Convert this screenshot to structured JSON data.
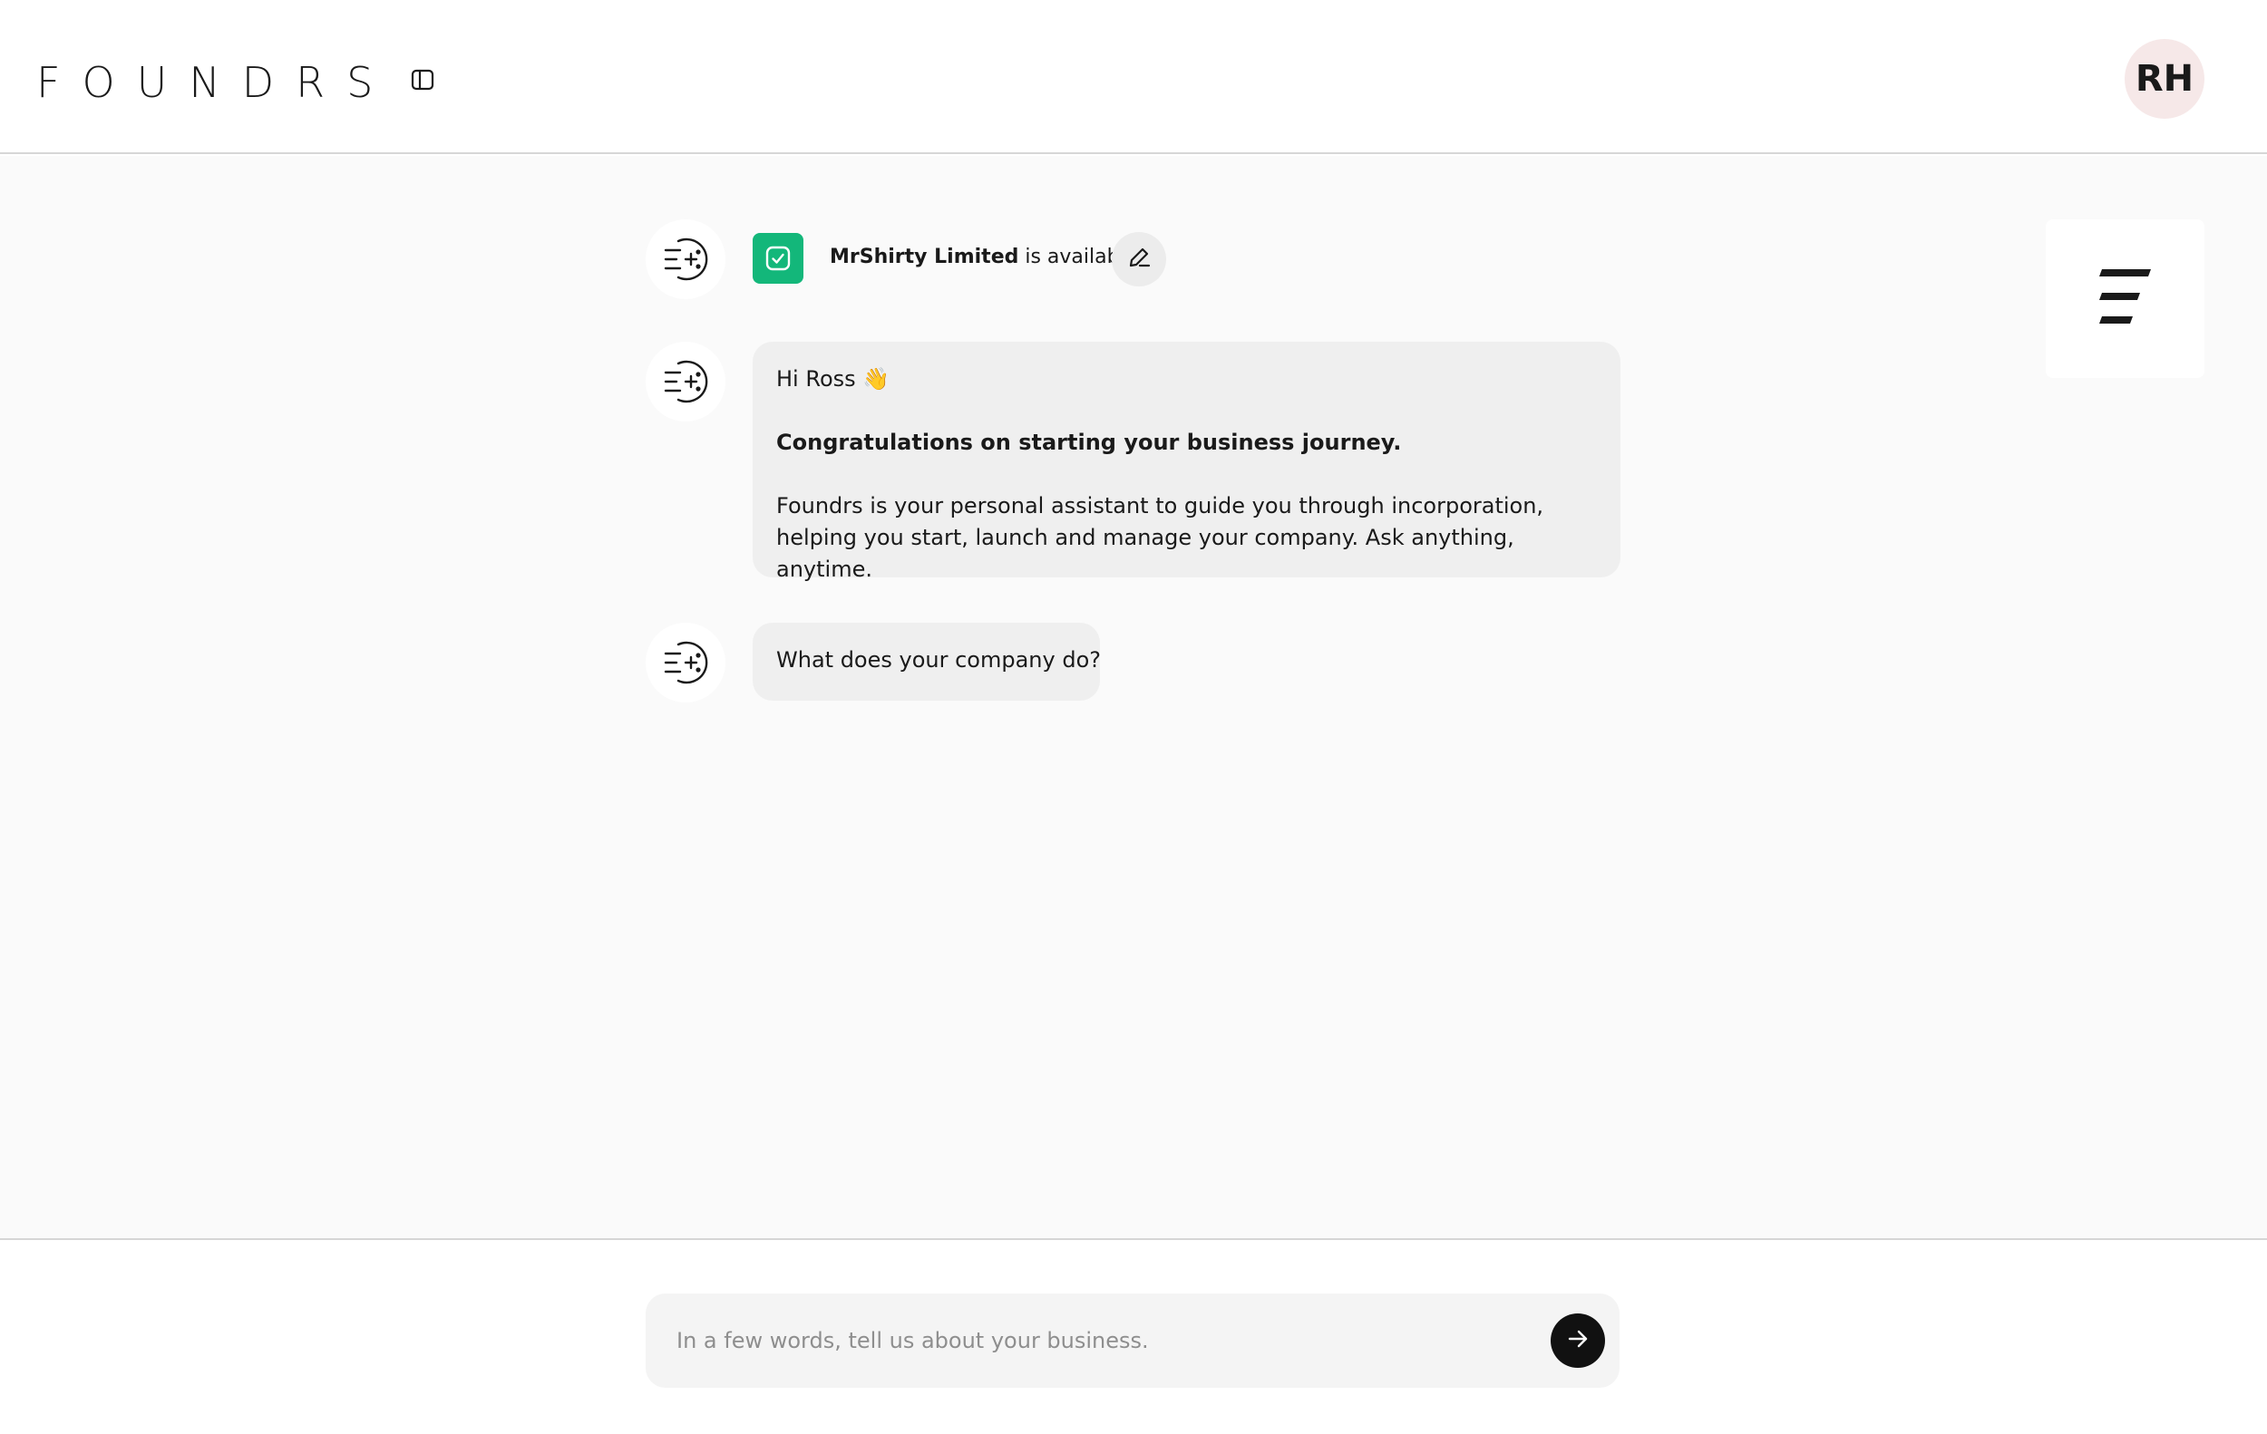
{
  "header": {
    "logo_text": "FOUNDRS",
    "avatar_initials": "RH"
  },
  "status": {
    "company_name": "MrShirty Limited",
    "availability_text": " is available"
  },
  "messages": [
    {
      "greeting": "Hi Ross 👋",
      "headline": "Congratulations on starting your business journey.",
      "body": "Foundrs is your personal assistant to guide you through incorporation, helping you start, launch and manage your company. Ask anything, anytime."
    },
    {
      "text": "What does your company do?"
    }
  ],
  "composer": {
    "placeholder": "In a few words, tell us about your business.",
    "value": ""
  },
  "icons": {
    "sidebar_toggle": "sidebar-panel-icon",
    "bot": "foundrs-sparkle-icon",
    "status": "check-square-icon",
    "edit": "pencil-icon",
    "menu": "menu-lines-icon",
    "send": "arrow-right-icon"
  },
  "colors": {
    "accent_green": "#13b77a",
    "send_button": "#111111",
    "avatar_bg": "#f6e8e8"
  }
}
